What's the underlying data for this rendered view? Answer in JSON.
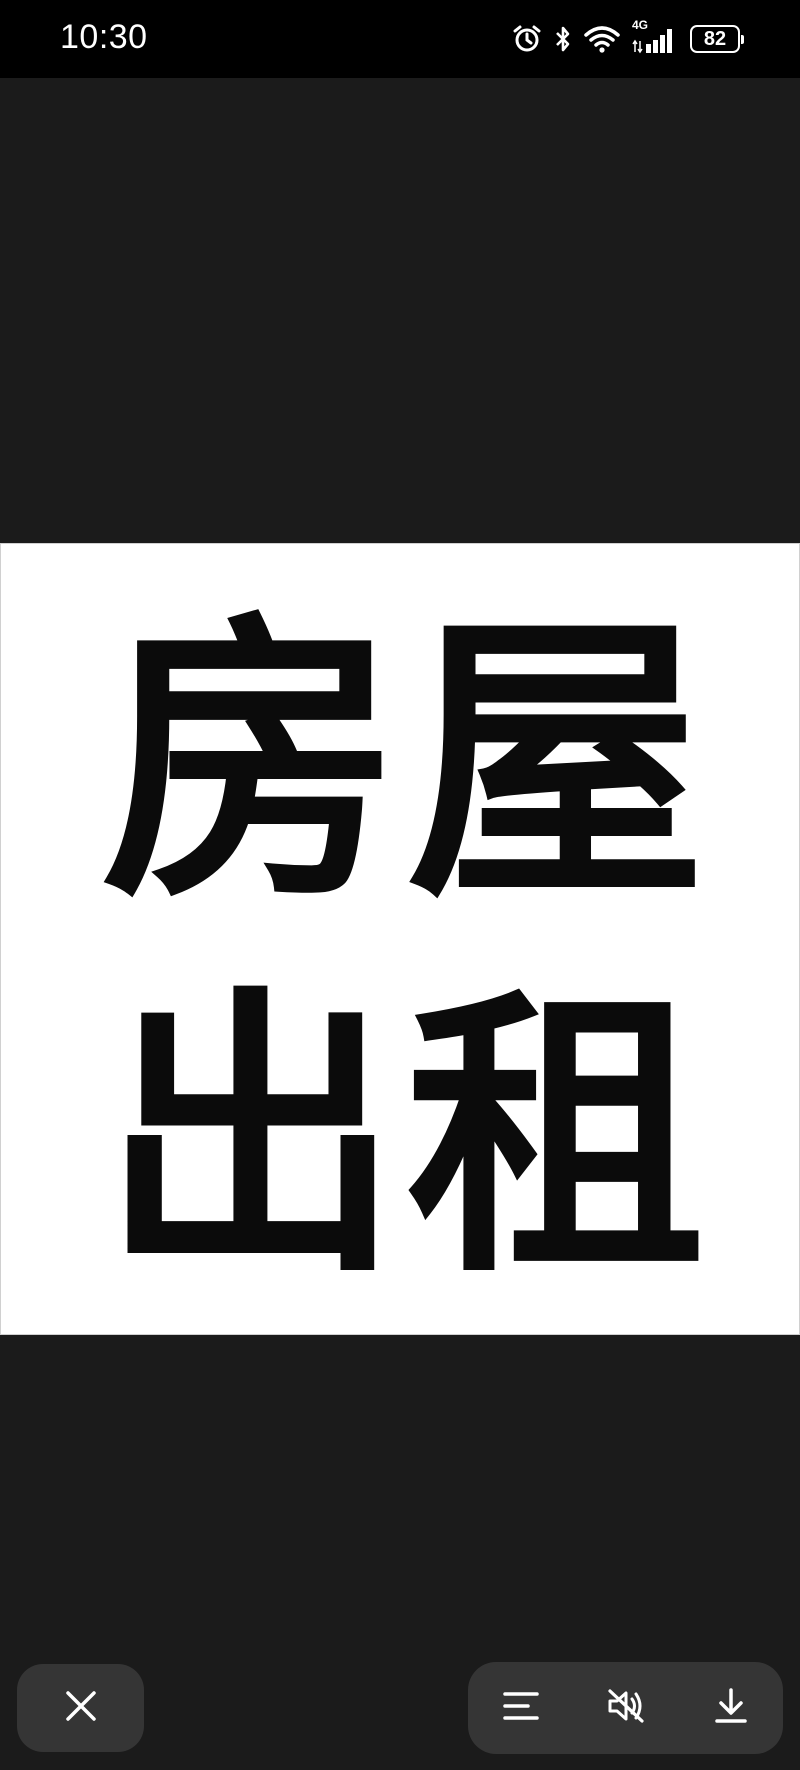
{
  "status_bar": {
    "time": "10:30",
    "network": "4G",
    "battery": "82",
    "icons": [
      "alarm-icon",
      "bluetooth-icon",
      "wifi-icon",
      "signal-icon",
      "battery-icon"
    ]
  },
  "image": {
    "characters": [
      "房",
      "屋",
      "出",
      "租"
    ],
    "background": "#ffffff",
    "text_color": "#0b0b0b"
  },
  "bottom_bar": {
    "close_icon": "close-icon",
    "actions": [
      "menu-icon",
      "mute-icon",
      "download-icon"
    ]
  },
  "colors": {
    "viewer_bg": "#1b1b1b",
    "button_bg": "#353535",
    "status_bg": "#000000"
  }
}
